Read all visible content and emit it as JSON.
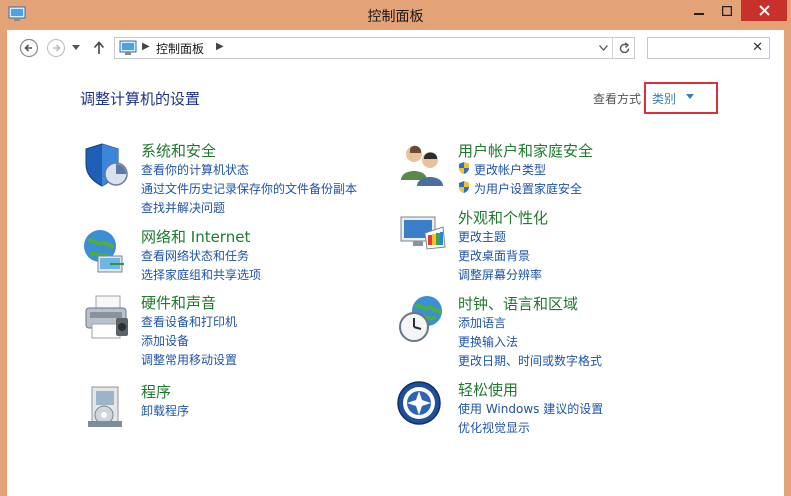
{
  "window": {
    "title": "控制面板"
  },
  "address": {
    "breadcrumb": "控制面板"
  },
  "search": {
    "placeholder": ""
  },
  "heading": "调整计算机的设置",
  "view_by": {
    "label": "查看方式",
    "selected": "类别"
  },
  "categories": [
    {
      "icon": "shield-security-icon",
      "title": "系统和安全",
      "links": [
        "查看你的计算机状态",
        "通过文件历史记录保存你的文件备份副本",
        "查找并解决问题"
      ]
    },
    {
      "icon": "globe-network-icon",
      "title": "网络和 Internet",
      "links": [
        "查看网络状态和任务",
        "选择家庭组和共享选项"
      ]
    },
    {
      "icon": "printer-icon",
      "title": "硬件和声音",
      "links": [
        "查看设备和打印机",
        "添加设备",
        "调整常用移动设置"
      ]
    },
    {
      "icon": "programs-box-icon",
      "title": "程序",
      "links": [
        "卸载程序"
      ]
    },
    {
      "icon": "users-icon",
      "title": "用户帐户和家庭安全",
      "links": [
        "更改帐户类型",
        "为用户设置家庭安全"
      ]
    },
    {
      "icon": "display-palette-icon",
      "title": "外观和个性化",
      "links": [
        "更改主题",
        "更改桌面背景",
        "调整屏幕分辨率"
      ]
    },
    {
      "icon": "clock-globe-icon",
      "title": "时钟、语言和区域",
      "links": [
        "添加语言",
        "更换输入法",
        "更改日期、时间或数字格式"
      ]
    },
    {
      "icon": "accessibility-icon",
      "title": "轻松使用",
      "links": [
        "使用 Windows 建议的设置",
        "优化视觉显示"
      ]
    }
  ],
  "colors": {
    "titlebar": "#e3a376",
    "close_button": "#c7302b",
    "category_title": "#1f7a2e",
    "link": "#1e54a8",
    "heading": "#1e3287",
    "highlight_border": "#d9313b"
  }
}
